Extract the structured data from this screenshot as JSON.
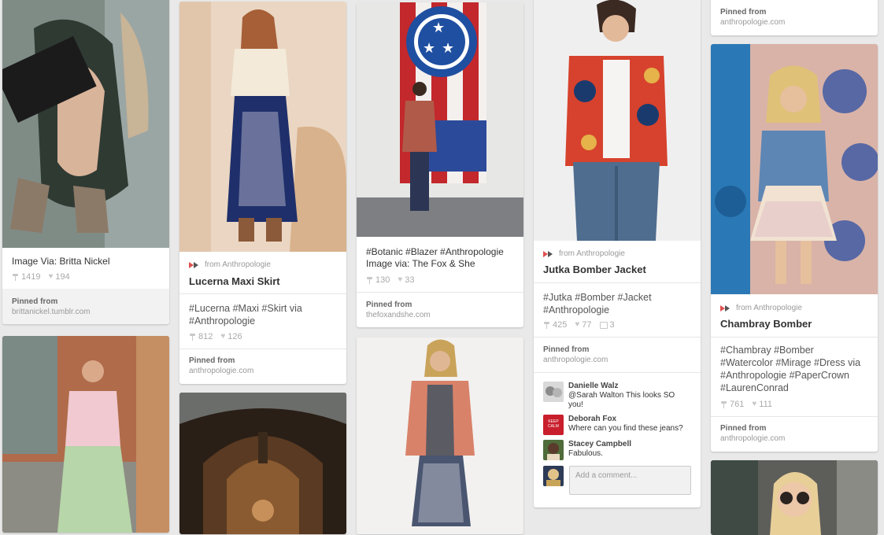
{
  "pins": {
    "p1": {
      "description": "Image Via: Britta Nickel",
      "repins": "1419",
      "likes": "194",
      "pinned_label": "Pinned from",
      "pinned_source": "brittanickel.tumblr.com"
    },
    "p2": {
      "from_label": "from Anthropologie",
      "title": "Lucerna Maxi Skirt",
      "description": "#Lucerna #Maxi #Skirt via #Anthropologie",
      "repins": "812",
      "likes": "126",
      "pinned_label": "Pinned from",
      "pinned_source": "anthropologie.com"
    },
    "p3": {
      "description": "#Botanic #Blazer #Anthropologie Image via: The Fox & She",
      "repins": "130",
      "likes": "33",
      "pinned_label": "Pinned from",
      "pinned_source": "thefoxandshe.com"
    },
    "p4": {
      "from_label": "from Anthropologie",
      "title": "Jutka Bomber Jacket",
      "description": "#Jutka #Bomber #Jacket #Anthropologie",
      "repins": "425",
      "likes": "77",
      "comments": "3",
      "pinned_label": "Pinned from",
      "pinned_source": "anthropologie.com",
      "comment_list": [
        {
          "user": "Danielle Walz",
          "text": "@Sarah Walton This looks SO you!"
        },
        {
          "user": "Deborah Fox",
          "text": "Where can you find these jeans?"
        },
        {
          "user": "Stacey Campbell",
          "text": "Fabulous."
        }
      ],
      "comment_placeholder": "Add a comment..."
    },
    "p5top": {
      "pinned_label": "Pinned from",
      "pinned_source": "anthropologie.com"
    },
    "p6": {
      "from_label": "from Anthropologie",
      "title": "Chambray Bomber",
      "description": "#Chambray #Bomber #Watercolor #Mirage #Dress via #Anthropologie #PaperCrown #LaurenConrad",
      "repins": "761",
      "likes": "111",
      "pinned_label": "Pinned from",
      "pinned_source": "anthropologie.com"
    }
  },
  "avatar_text": "KEEP CALM"
}
